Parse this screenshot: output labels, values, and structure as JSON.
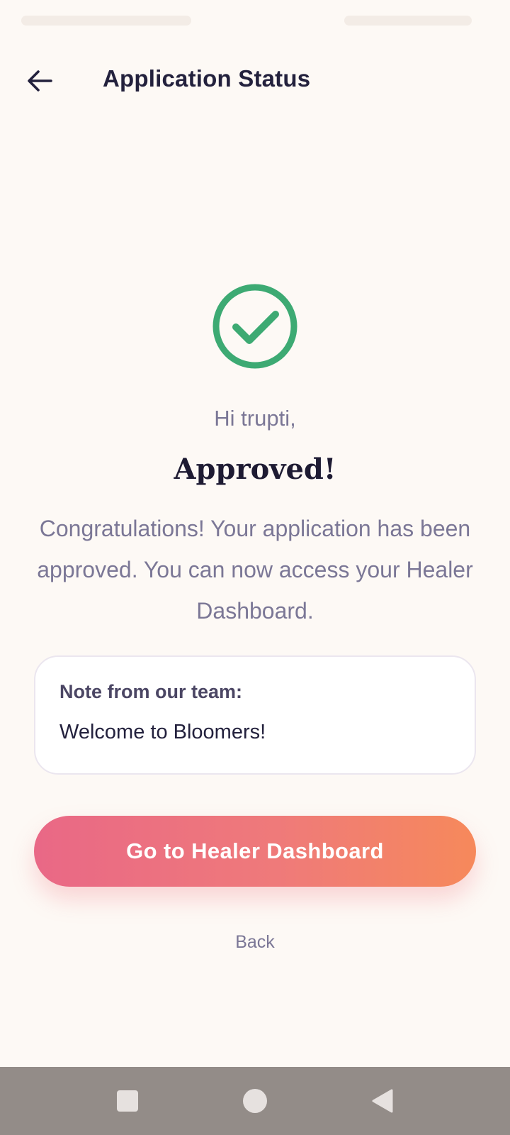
{
  "header": {
    "title": "Application Status",
    "back_icon": "arrow-left-icon"
  },
  "status": {
    "icon": "check-circle-icon",
    "icon_color": "#3daa73",
    "greeting": "Hi trupti,",
    "heading": "Approved!",
    "message": "Congratulations! Your application has been approved. You can now access your Healer Dashboard."
  },
  "note": {
    "title": "Note from our team:",
    "body": "Welcome to Bloomers!"
  },
  "actions": {
    "primary_label": "Go to Healer Dashboard",
    "secondary_label": "Back"
  },
  "colors": {
    "background": "#fdf9f5",
    "title_text": "#23213d",
    "muted_text": "#7b7796",
    "gradient_start": "#e96886",
    "gradient_end": "#f6895b",
    "nav_bar": "#938c88"
  },
  "nav_bar": {
    "recent_icon": "square-icon",
    "home_icon": "circle-icon",
    "back_icon": "triangle-back-icon"
  }
}
